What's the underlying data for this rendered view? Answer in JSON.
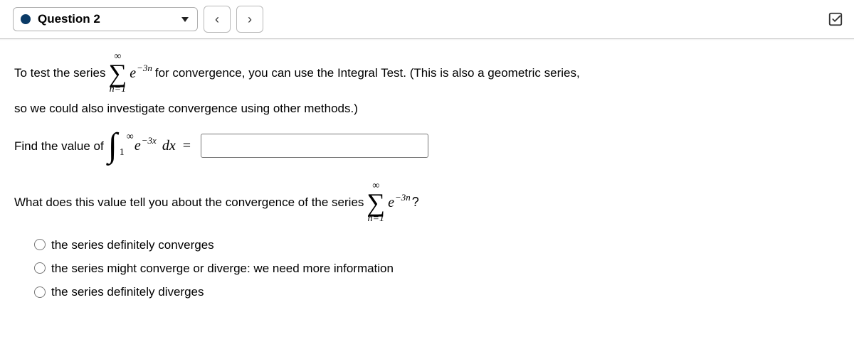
{
  "header": {
    "title": "Question 2",
    "prev": "‹",
    "next": "›"
  },
  "math": {
    "sum_upper": "∞",
    "sum_lower": "n=1",
    "e_base": "e",
    "exp_neg3n_html": "−3<span style=\"font-style:italic\">n</span>",
    "exp_neg3x_html": "−3<span style=\"font-style:italic\">x</span>",
    "int_upper": "∞",
    "int_lower": "1",
    "dx": "dx",
    "equals": "="
  },
  "text": {
    "p1a": "To test the series ",
    "p1b": " for convergence, you can use the Integral Test. (This is also a geometric series,",
    "p2": "so we could also investigate convergence using other methods.)",
    "p3": "Find the value of ",
    "p4": "What does this value tell you about the convergence of the series ",
    "qmark": "?"
  },
  "options": [
    "the series definitely converges",
    "the series might converge or diverge: we need more information",
    "the series definitely diverges"
  ]
}
